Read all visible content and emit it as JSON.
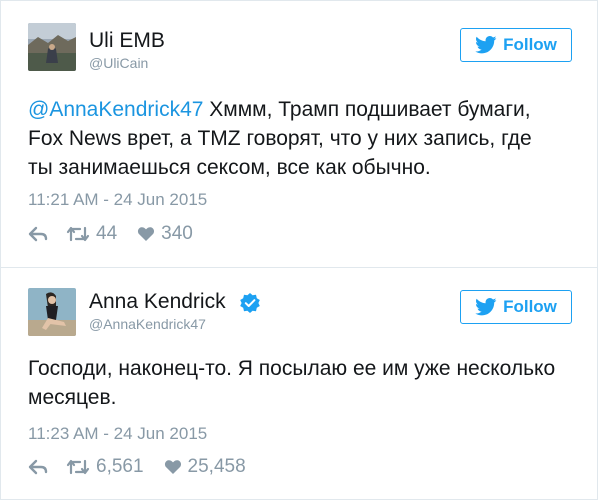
{
  "tweets": [
    {
      "author_name": "Uli EMB",
      "handle": "@UliCain",
      "verified": false,
      "follow_label": "Follow",
      "mention": "@AnnaKendrick47",
      "lines": [
        " Хммм, Трамп подшивает бумаги,",
        "Fox News врет, а TMZ говорят, что у них запись, где",
        "ты занимаешься сексом, все как обычно."
      ],
      "timestamp": "11:21 AM - 24 Jun 2015",
      "retweets": "44",
      "likes": "340"
    },
    {
      "author_name": "Anna Kendrick",
      "handle": "@AnnaKendrick47",
      "verified": true,
      "follow_label": "Follow",
      "lines": [
        "Господи, наконец-то. Я посылаю ее им уже несколько",
        "месяцев."
      ],
      "timestamp": "11:23 AM - 24 Jun 2015",
      "retweets": "6,561",
      "likes": "25,458"
    }
  ],
  "colors": {
    "twitter_blue": "#1da1f2",
    "mention_blue": "#1b95e0",
    "verified_blue": "#1da1f2",
    "meta_gray": "#8899a6"
  },
  "icons": {
    "follow": "twitter-bird-icon",
    "reply": "reply-icon",
    "retweet": "retweet-icon",
    "like": "heart-icon",
    "verified": "verified-badge-icon"
  }
}
